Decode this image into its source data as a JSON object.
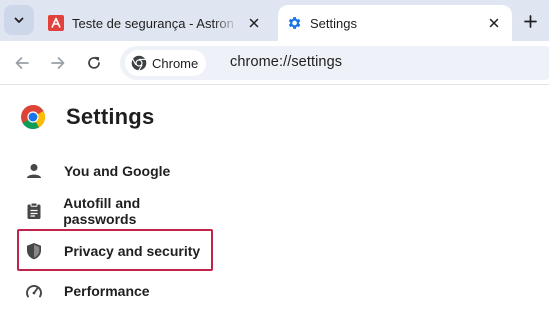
{
  "tabs": [
    {
      "title": "Teste de segurança - Astron Me",
      "favicon": "astron-icon",
      "active": false,
      "close_icon": "close-icon"
    },
    {
      "title": "Settings",
      "favicon": "gear-icon",
      "active": true,
      "close_icon": "close-icon"
    }
  ],
  "tabstrip": {
    "search_icon": "chevron-down-icon",
    "new_tab_icon": "plus-icon"
  },
  "toolbar": {
    "back_icon": "arrow-left-icon",
    "forward_icon": "arrow-right-icon",
    "reload_icon": "reload-icon",
    "chip_label": "Chrome",
    "url": "chrome://settings"
  },
  "page": {
    "title": "Settings",
    "menu": [
      {
        "label": "You and Google",
        "icon": "person-icon"
      },
      {
        "label": "Autofill and passwords",
        "icon": "clipboard-icon"
      },
      {
        "label": "Privacy and security",
        "icon": "shield-icon",
        "highlighted": true
      },
      {
        "label": "Performance",
        "icon": "speedometer-icon"
      }
    ]
  },
  "colors": {
    "tabstrip_bg": "#dfe5f1",
    "omnibox_bg": "#eef1f8",
    "accent_blue": "#1a73e8",
    "highlight_border": "#c2234a",
    "astron_red": "#e2403c"
  }
}
